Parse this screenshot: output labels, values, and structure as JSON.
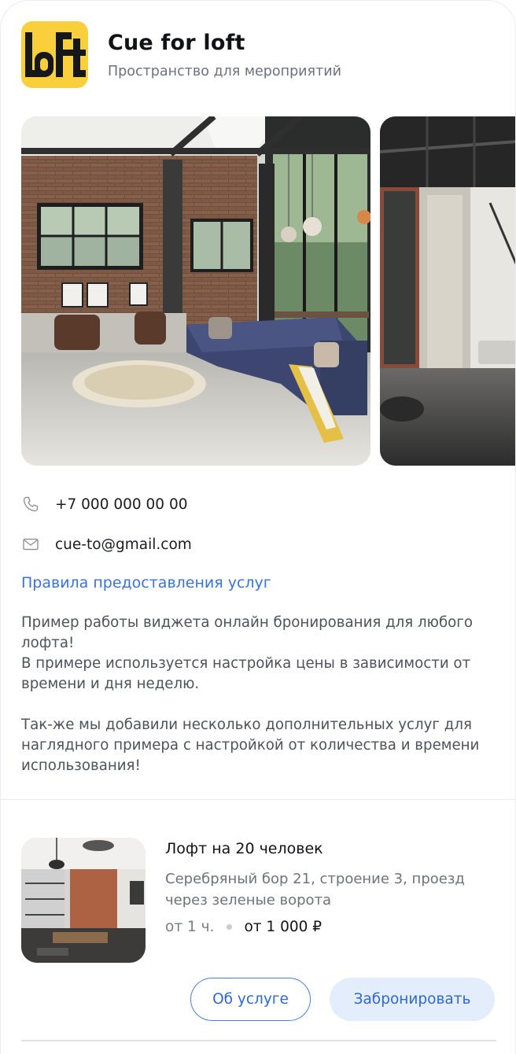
{
  "header": {
    "logo_text": "LoFt",
    "title": "Cue for loft",
    "subtitle": "Пространство для мероприятий"
  },
  "gallery": {
    "photos": [
      "loft-living-room-photo",
      "loft-interior-photo-2"
    ]
  },
  "contacts": {
    "phone": "+7 000 000 00 00",
    "email": "cue-to@gmail.com"
  },
  "rules_link": "Правила предоставления услуг",
  "description": {
    "line1": "Пример работы виджета онлайн бронирования для любого",
    "line2": "лофта!",
    "line3": "В примере используется настройка цены в зависимости от",
    "line4": "времени и дня неделю.",
    "line5": "Так-же мы добавили несколько дополнительных услуг для",
    "line6": "наглядного примера с настройкой от количества и времени",
    "line7": "использования!"
  },
  "service": {
    "name": "Лофт на 20 человек",
    "address_line1": "Серебряный бор 21, строение 3, проезд",
    "address_line2": "через зеленые ворота",
    "duration": "от 1 ч.",
    "price": "от 1 000 ₽",
    "about_button": "Об услуге",
    "book_button": "Забронировать"
  },
  "colors": {
    "accent": "#3a73d8",
    "logo_bg": "#f9cf3b",
    "button_fill": "#e3edfb"
  },
  "icons": [
    "phone-icon",
    "mail-icon"
  ]
}
